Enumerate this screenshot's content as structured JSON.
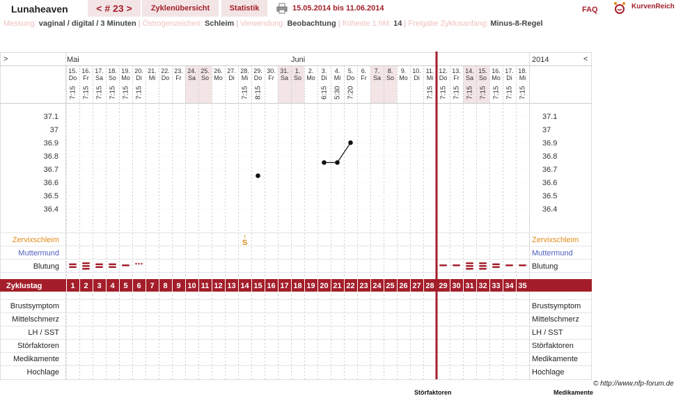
{
  "topbar": {
    "title": "Lunaheaven",
    "cycle_nav": "< # 23 >",
    "tab_overview": "Zyklenübersicht",
    "tab_stats": "Statistik",
    "date_range": "15.05.2014 bis 11.06.2014",
    "faq": "FAQ",
    "logo_text": "KurvenReich"
  },
  "info": [
    {
      "label": "Messung:",
      "value": "vaginal / digital / 3 Minuten"
    },
    {
      "label": "Östrogenzeichen:",
      "value": "Schleim"
    },
    {
      "label": "Verwendung:",
      "value": "Beobachtung"
    },
    {
      "label": "früheste 1.hM:",
      "value": "14"
    },
    {
      "label": "Freigabe Zyklusanfang:",
      "value": "Minus-8-Regel"
    }
  ],
  "header": {
    "left_arrow": ">",
    "right_arrow": "<",
    "year": "2014",
    "months": [
      "Mai",
      "Juni"
    ]
  },
  "days": [
    {
      "d": "15.",
      "w": "Do",
      "t": "7:15",
      "c": 1,
      "we": false
    },
    {
      "d": "16.",
      "w": "Fr",
      "t": "7:15",
      "c": 2,
      "we": false
    },
    {
      "d": "17.",
      "w": "Sa",
      "t": "7:15",
      "c": 3,
      "we": false
    },
    {
      "d": "18.",
      "w": "So",
      "t": "7:15",
      "c": 4,
      "we": false
    },
    {
      "d": "19.",
      "w": "Mo",
      "t": "7:15",
      "c": 5,
      "we": false
    },
    {
      "d": "20.",
      "w": "Di",
      "t": "7:15",
      "c": 6,
      "we": false
    },
    {
      "d": "21.",
      "w": "Mi",
      "t": "",
      "c": 7,
      "we": false
    },
    {
      "d": "22.",
      "w": "Do",
      "t": "",
      "c": 8,
      "we": false
    },
    {
      "d": "23.",
      "w": "Fr",
      "t": "",
      "c": 9,
      "we": false
    },
    {
      "d": "24.",
      "w": "Sa",
      "t": "",
      "c": 10,
      "we": true
    },
    {
      "d": "25.",
      "w": "So",
      "t": "",
      "c": 11,
      "we": true
    },
    {
      "d": "26.",
      "w": "Mo",
      "t": "",
      "c": 12,
      "we": false
    },
    {
      "d": "27.",
      "w": "Di",
      "t": "",
      "c": 13,
      "we": false
    },
    {
      "d": "28.",
      "w": "Mi",
      "t": "7:15",
      "c": 14,
      "we": false
    },
    {
      "d": "29.",
      "w": "Do",
      "t": "8:15",
      "c": 15,
      "we": false
    },
    {
      "d": "30.",
      "w": "Fr",
      "t": "",
      "c": 16,
      "we": false
    },
    {
      "d": "31.",
      "w": "Sa",
      "t": "",
      "c": 17,
      "we": true
    },
    {
      "d": "1.",
      "w": "So",
      "t": "",
      "c": 18,
      "we": true
    },
    {
      "d": "2.",
      "w": "Mo",
      "t": "",
      "c": 19,
      "we": false
    },
    {
      "d": "3.",
      "w": "Di",
      "t": "6:15",
      "c": 20,
      "we": false
    },
    {
      "d": "4.",
      "w": "Mi",
      "t": "5:30",
      "c": 21,
      "we": false
    },
    {
      "d": "5.",
      "w": "Do",
      "t": "7:20",
      "c": 22,
      "we": false
    },
    {
      "d": "6.",
      "w": "Fr",
      "t": "",
      "c": 23,
      "we": false
    },
    {
      "d": "7.",
      "w": "Sa",
      "t": "",
      "c": 24,
      "we": true
    },
    {
      "d": "8.",
      "w": "So",
      "t": "",
      "c": 25,
      "we": true
    },
    {
      "d": "9.",
      "w": "Mo",
      "t": "",
      "c": 26,
      "we": false
    },
    {
      "d": "10.",
      "w": "Di",
      "t": "",
      "c": 27,
      "we": false
    },
    {
      "d": "11.",
      "w": "Mi",
      "t": "7:15",
      "c": 28,
      "we": false
    },
    {
      "d": "12.",
      "w": "Do",
      "t": "7:15",
      "c": 29,
      "we": false
    },
    {
      "d": "13.",
      "w": "Fr",
      "t": "7:15",
      "c": 30,
      "we": false
    },
    {
      "d": "14.",
      "w": "Sa",
      "t": "7:15",
      "c": 31,
      "we": true
    },
    {
      "d": "15.",
      "w": "So",
      "t": "7:15",
      "c": 32,
      "we": true
    },
    {
      "d": "16.",
      "w": "Mo",
      "t": "7:15",
      "c": 33,
      "we": false
    },
    {
      "d": "17.",
      "w": "Di",
      "t": "7:15",
      "c": 34,
      "we": false
    },
    {
      "d": "18.",
      "w": "Mi",
      "t": "7:15",
      "c": 35,
      "we": false
    }
  ],
  "temperature_axis": [
    "37.1",
    "37",
    "36.9",
    "36.8",
    "36.7",
    "36.6",
    "36.5",
    "36.4"
  ],
  "temperatures": [
    {
      "day": 15,
      "value": 36.65
    },
    {
      "day": 20,
      "value": 36.75
    },
    {
      "day": 21,
      "value": 36.75
    },
    {
      "day": 22,
      "value": 36.9
    }
  ],
  "connected_days": [
    20,
    21,
    22
  ],
  "mucus": {
    "day": 14,
    "symbol": "S",
    "mark": "t"
  },
  "bleeding": [
    {
      "day": 1,
      "level": "stark"
    },
    {
      "day": 2,
      "level": "sehr stark"
    },
    {
      "day": 3,
      "level": "stark"
    },
    {
      "day": 4,
      "level": "stark"
    },
    {
      "day": 5,
      "level": "mittel"
    },
    {
      "day": 6,
      "level": "schmierblutung"
    },
    {
      "day": 29,
      "level": "mittel"
    },
    {
      "day": 30,
      "level": "mittel"
    },
    {
      "day": 31,
      "level": "sehr stark"
    },
    {
      "day": 32,
      "level": "sehr stark"
    },
    {
      "day": 33,
      "level": "stark"
    },
    {
      "day": 34,
      "level": "mittel"
    },
    {
      "day": 35,
      "level": "mittel"
    }
  ],
  "labels": {
    "zervix": "Zervixschleim",
    "muttermund": "Muttermund",
    "blutung": "Blutung",
    "zyklustag": "Zyklustag",
    "bottom": [
      "Brustsymptom",
      "Mittelschmerz",
      "LH / SST",
      "Störfaktoren",
      "Medikamente",
      "Hochlage"
    ]
  },
  "colors": {
    "accent": "#a31e2a",
    "zervix": "#e08a1a",
    "muttermund": "#5060c0",
    "weekend": "#f3e5e6"
  },
  "footer": {
    "copyright": "© http://www.nfp-forum.de",
    "stray1": "Störfaktoren",
    "stray2": "Medikamente"
  }
}
